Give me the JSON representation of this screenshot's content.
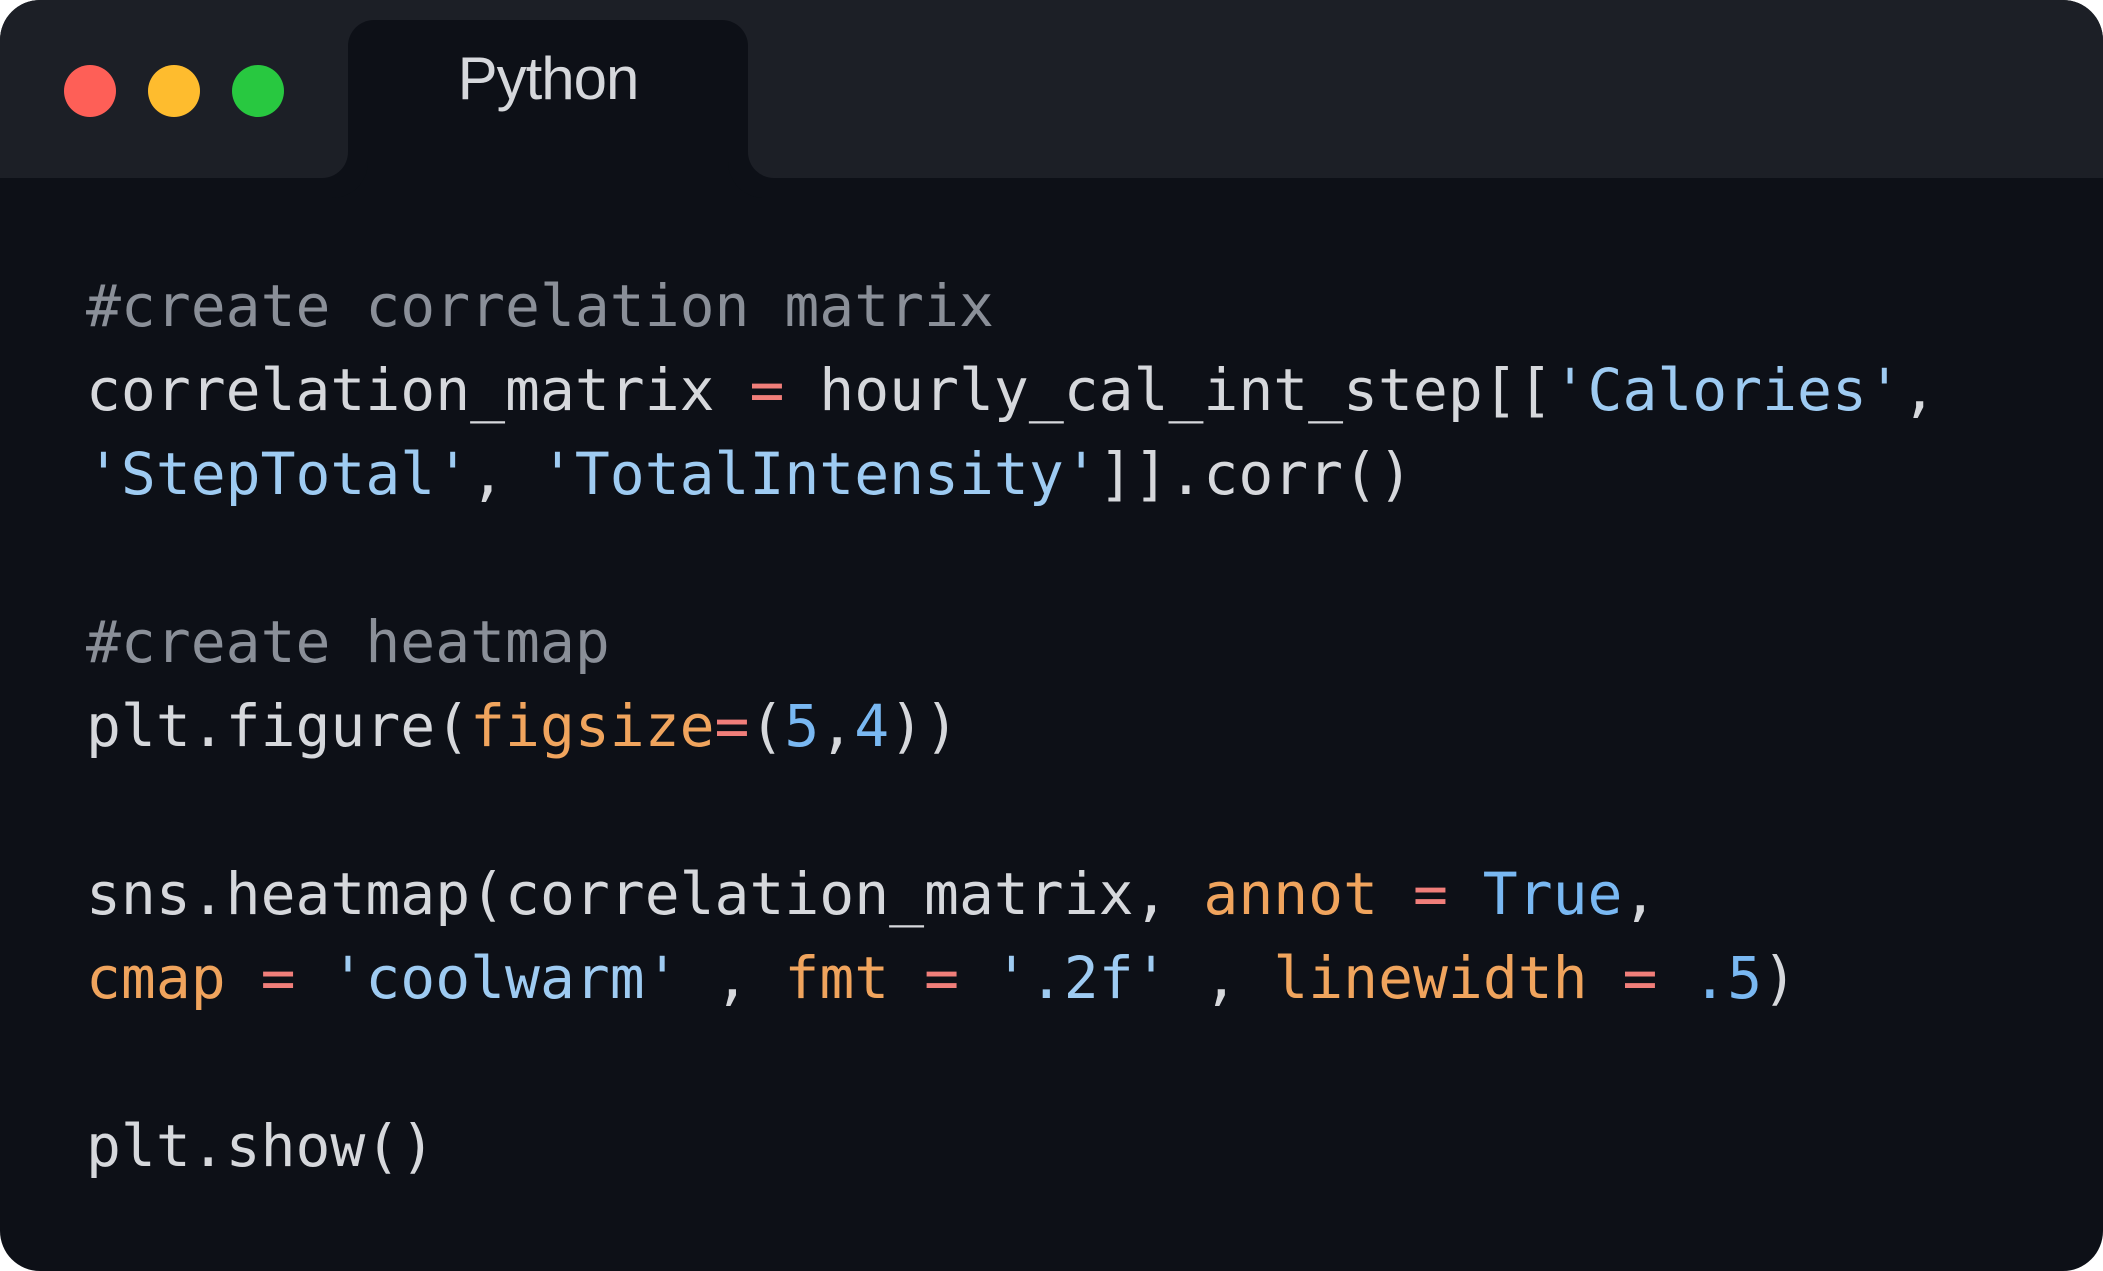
{
  "window": {
    "tab_label": "Python",
    "colors": {
      "background": "#0d1017",
      "titlebar": "#1c1f26",
      "close": "#fe5f57",
      "minimize": "#febc2e",
      "maximize": "#28c840"
    }
  },
  "code": {
    "lines": [
      [
        {
          "t": "comment",
          "v": "#create correlation matrix"
        }
      ],
      [
        {
          "t": "default",
          "v": "correlation_matrix "
        },
        {
          "t": "op",
          "v": "="
        },
        {
          "t": "default",
          "v": " hourly_cal_int_step[["
        },
        {
          "t": "string",
          "v": "'Calories'"
        },
        {
          "t": "default",
          "v": ","
        }
      ],
      [
        {
          "t": "string",
          "v": "'StepTotal'"
        },
        {
          "t": "default",
          "v": ", "
        },
        {
          "t": "string",
          "v": "'TotalIntensity'"
        },
        {
          "t": "default",
          "v": "]].corr()"
        }
      ],
      [],
      [
        {
          "t": "comment",
          "v": "#create heatmap"
        }
      ],
      [
        {
          "t": "default",
          "v": "plt.figure("
        },
        {
          "t": "param",
          "v": "figsize"
        },
        {
          "t": "op",
          "v": "="
        },
        {
          "t": "default",
          "v": "("
        },
        {
          "t": "number",
          "v": "5"
        },
        {
          "t": "default",
          "v": ","
        },
        {
          "t": "number",
          "v": "4"
        },
        {
          "t": "default",
          "v": "))"
        }
      ],
      [],
      [
        {
          "t": "default",
          "v": "sns.heatmap(correlation_matrix, "
        },
        {
          "t": "param",
          "v": "annot"
        },
        {
          "t": "default",
          "v": " "
        },
        {
          "t": "op",
          "v": "="
        },
        {
          "t": "default",
          "v": " "
        },
        {
          "t": "keyword",
          "v": "True"
        },
        {
          "t": "default",
          "v": ","
        }
      ],
      [
        {
          "t": "param",
          "v": "cmap"
        },
        {
          "t": "default",
          "v": " "
        },
        {
          "t": "op",
          "v": "="
        },
        {
          "t": "default",
          "v": " "
        },
        {
          "t": "string",
          "v": "'coolwarm'"
        },
        {
          "t": "default",
          "v": " , "
        },
        {
          "t": "param",
          "v": "fmt"
        },
        {
          "t": "default",
          "v": " "
        },
        {
          "t": "op",
          "v": "="
        },
        {
          "t": "default",
          "v": " "
        },
        {
          "t": "string",
          "v": "'.2f'"
        },
        {
          "t": "default",
          "v": " , "
        },
        {
          "t": "param",
          "v": "linewidth"
        },
        {
          "t": "default",
          "v": " "
        },
        {
          "t": "op",
          "v": "="
        },
        {
          "t": "default",
          "v": " "
        },
        {
          "t": "number",
          "v": ".5"
        },
        {
          "t": "default",
          "v": ")"
        }
      ],
      [],
      [
        {
          "t": "default",
          "v": "plt.show()"
        }
      ]
    ]
  }
}
